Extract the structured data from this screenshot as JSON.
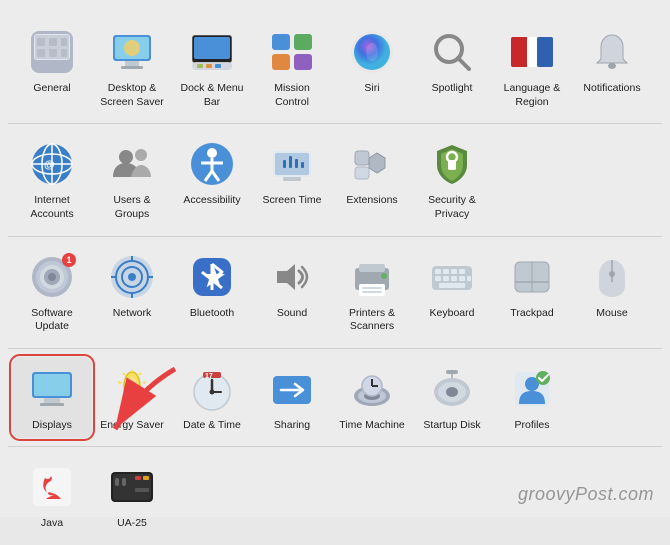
{
  "sections": [
    {
      "items": [
        {
          "id": "general",
          "label": "General",
          "icon": "general"
        },
        {
          "id": "desktop-screensaver",
          "label": "Desktop &\nScreen Saver",
          "icon": "desktop"
        },
        {
          "id": "dock-menubar",
          "label": "Dock &\nMenu Bar",
          "icon": "dock"
        },
        {
          "id": "mission-control",
          "label": "Mission\nControl",
          "icon": "mission"
        },
        {
          "id": "siri",
          "label": "Siri",
          "icon": "siri"
        },
        {
          "id": "spotlight",
          "label": "Spotlight",
          "icon": "spotlight"
        },
        {
          "id": "language-region",
          "label": "Language\n& Region",
          "icon": "language"
        },
        {
          "id": "notifications",
          "label": "Notifications",
          "icon": "notifications",
          "badge": ""
        }
      ]
    },
    {
      "items": [
        {
          "id": "internet-accounts",
          "label": "Internet\nAccounts",
          "icon": "internet"
        },
        {
          "id": "users-groups",
          "label": "Users &\nGroups",
          "icon": "users"
        },
        {
          "id": "accessibility",
          "label": "Accessibility",
          "icon": "accessibility"
        },
        {
          "id": "screen-time",
          "label": "Screen Time",
          "icon": "screentime"
        },
        {
          "id": "extensions",
          "label": "Extensions",
          "icon": "extensions"
        },
        {
          "id": "security-privacy",
          "label": "Security\n& Privacy",
          "icon": "security"
        }
      ]
    },
    {
      "items": [
        {
          "id": "software-update",
          "label": "Software\nUpdate",
          "icon": "softwareupdate",
          "badge": "1"
        },
        {
          "id": "network",
          "label": "Network",
          "icon": "network"
        },
        {
          "id": "bluetooth",
          "label": "Bluetooth",
          "icon": "bluetooth"
        },
        {
          "id": "sound",
          "label": "Sound",
          "icon": "sound"
        },
        {
          "id": "printers-scanners",
          "label": "Printers &\nScanners",
          "icon": "printers"
        },
        {
          "id": "keyboard",
          "label": "Keyboard",
          "icon": "keyboard"
        },
        {
          "id": "trackpad",
          "label": "Trackpad",
          "icon": "trackpad"
        },
        {
          "id": "mouse",
          "label": "Mouse",
          "icon": "mouse"
        }
      ]
    },
    {
      "items": [
        {
          "id": "displays",
          "label": "Displays",
          "icon": "displays",
          "selected": true
        },
        {
          "id": "energy-saver",
          "label": "Energy\nSaver",
          "icon": "energy"
        },
        {
          "id": "date-time",
          "label": "Date & Time",
          "icon": "datetime"
        },
        {
          "id": "sharing",
          "label": "Sharing",
          "icon": "sharing"
        },
        {
          "id": "time-machine",
          "label": "Time\nMachine",
          "icon": "timemachine"
        },
        {
          "id": "startup-disk",
          "label": "Startup\nDisk",
          "icon": "startup"
        },
        {
          "id": "profiles",
          "label": "Profiles",
          "icon": "profiles"
        }
      ]
    },
    {
      "items": [
        {
          "id": "java",
          "label": "Java",
          "icon": "java"
        },
        {
          "id": "ua25",
          "label": "UA-25",
          "icon": "ua25"
        }
      ]
    }
  ],
  "watermark": "groovyPost.com"
}
